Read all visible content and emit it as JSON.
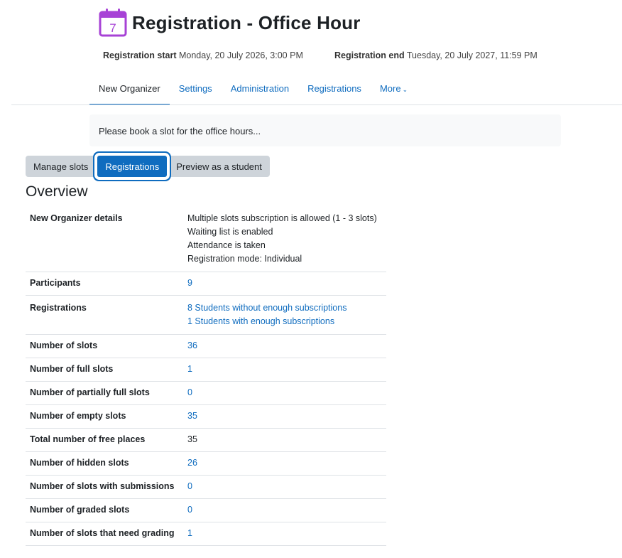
{
  "page": {
    "title": "Registration - Office Hour",
    "calendar_day": "7",
    "accent": "#a742d6",
    "link_color": "#0f6cbf"
  },
  "dates": {
    "start_label": "Registration start",
    "start_value": "Monday, 20 July 2026, 3:00 PM",
    "end_label": "Registration end",
    "end_value": "Tuesday, 20 July 2027, 11:59 PM"
  },
  "nav": {
    "items": [
      "New Organizer",
      "Settings",
      "Administration",
      "Registrations"
    ],
    "more_label": "More",
    "active": "New Organizer"
  },
  "intro": "Please book a slot for the office hours...",
  "tabs": {
    "items": [
      "Manage slots",
      "Registrations",
      "Preview as a student"
    ],
    "active": "Registrations"
  },
  "overview": {
    "heading": "Overview",
    "details_label": "New Organizer details",
    "details_lines": [
      "Multiple slots subscription is allowed (1 - 3 slots)",
      "Waiting list is enabled",
      "Attendance is taken",
      "Registration mode: Individual"
    ],
    "participants_label": "Participants",
    "participants_value": "9",
    "registrations_label": "Registrations",
    "registrations_lines": [
      "8 Students without enough subscriptions",
      "1 Students with enough subscriptions"
    ],
    "rows": [
      {
        "label": "Number of slots",
        "value": "36",
        "link": true
      },
      {
        "label": "Number of full slots",
        "value": "1",
        "link": true
      },
      {
        "label": "Number of partially full slots",
        "value": "0",
        "link": true
      },
      {
        "label": "Number of empty slots",
        "value": "35",
        "link": true
      },
      {
        "label": "Total number of free places",
        "value": "35",
        "link": false
      },
      {
        "label": "Number of hidden slots",
        "value": "26",
        "link": true
      },
      {
        "label": "Number of slots with submissions",
        "value": "0",
        "link": true
      },
      {
        "label": "Number of graded slots",
        "value": "0",
        "link": true
      },
      {
        "label": "Number of slots that need grading",
        "value": "1",
        "link": true
      }
    ]
  }
}
